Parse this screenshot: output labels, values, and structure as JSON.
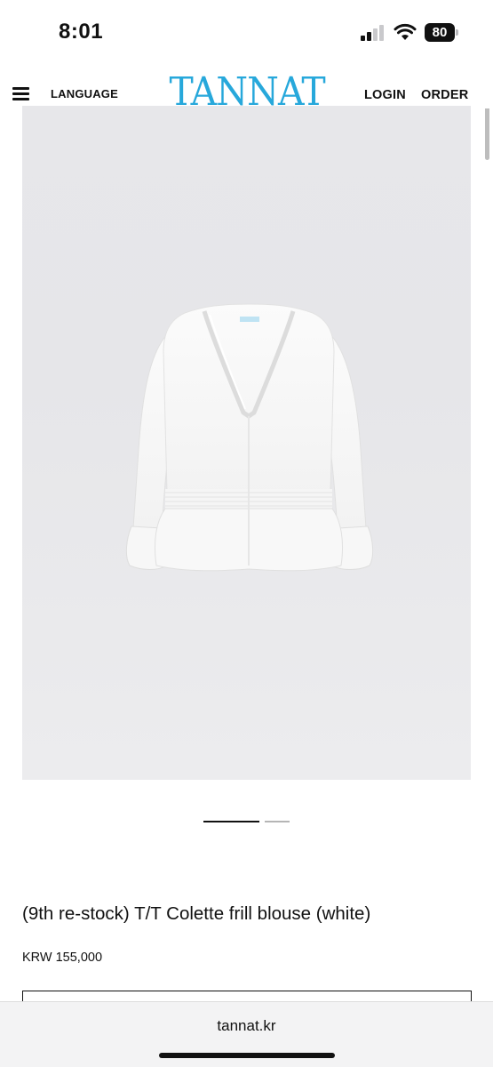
{
  "status_bar": {
    "time": "8:01",
    "battery_level": "80",
    "icons": [
      "signal-icon",
      "wifi-icon",
      "battery-icon"
    ]
  },
  "header": {
    "menu_icon": "menu-icon",
    "language_label": "LANGUAGE",
    "logo_text": "TANNAT",
    "login_label": "LOGIN",
    "order_label": "ORDER",
    "logo_color": "#27a8db"
  },
  "product": {
    "image_icon": "blouse-image",
    "carousel": {
      "current": 1,
      "total": 2
    },
    "title": "(9th re-stock) T/T Colette frill blouse (white)",
    "price": "KRW 155,000"
  },
  "browser": {
    "url": "tannat.kr"
  }
}
